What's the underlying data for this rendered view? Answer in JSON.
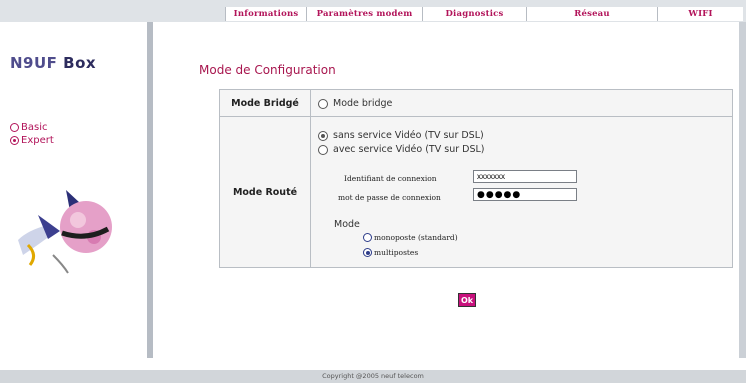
{
  "nav": {
    "tabs": [
      {
        "label": "Informations",
        "width": 80
      },
      {
        "label": "Paramètres modem",
        "width": 115
      },
      {
        "label": "Diagnostics",
        "width": 103
      },
      {
        "label": "Réseau",
        "width": 130
      },
      {
        "label": "WIFI",
        "width": 85
      }
    ]
  },
  "sidebar": {
    "logo_main": "N9UF",
    "logo_box": "Box",
    "basic": "Basic",
    "expert": "Expert",
    "selected": "Expert"
  },
  "main": {
    "title": "Mode de Configuration",
    "bridge": {
      "label": "Mode Bridgé",
      "option": "Mode bridge"
    },
    "routed": {
      "label": "Mode Routé",
      "opt_no_video": "sans service Vidéo (TV sur DSL)",
      "opt_video": "avec service Vidéo (TV sur DSL)",
      "selected": "sans service Vidéo (TV sur DSL)",
      "login_label": "Identifiant de connexion",
      "login_value": "xxxxxxx",
      "password_label": "mot de passe de connexion",
      "password_value": "●●●●●",
      "mode_title": "Mode",
      "mode_mono": "monoposte (standard)",
      "mode_multi": "multipostes",
      "mode_selected": "multipostes"
    },
    "ok_label": "Ok"
  },
  "footer": {
    "copyright": "Copyright @2005 neuf telecom"
  },
  "colors": {
    "accent": "#b2145a",
    "button": "#c8117d"
  }
}
